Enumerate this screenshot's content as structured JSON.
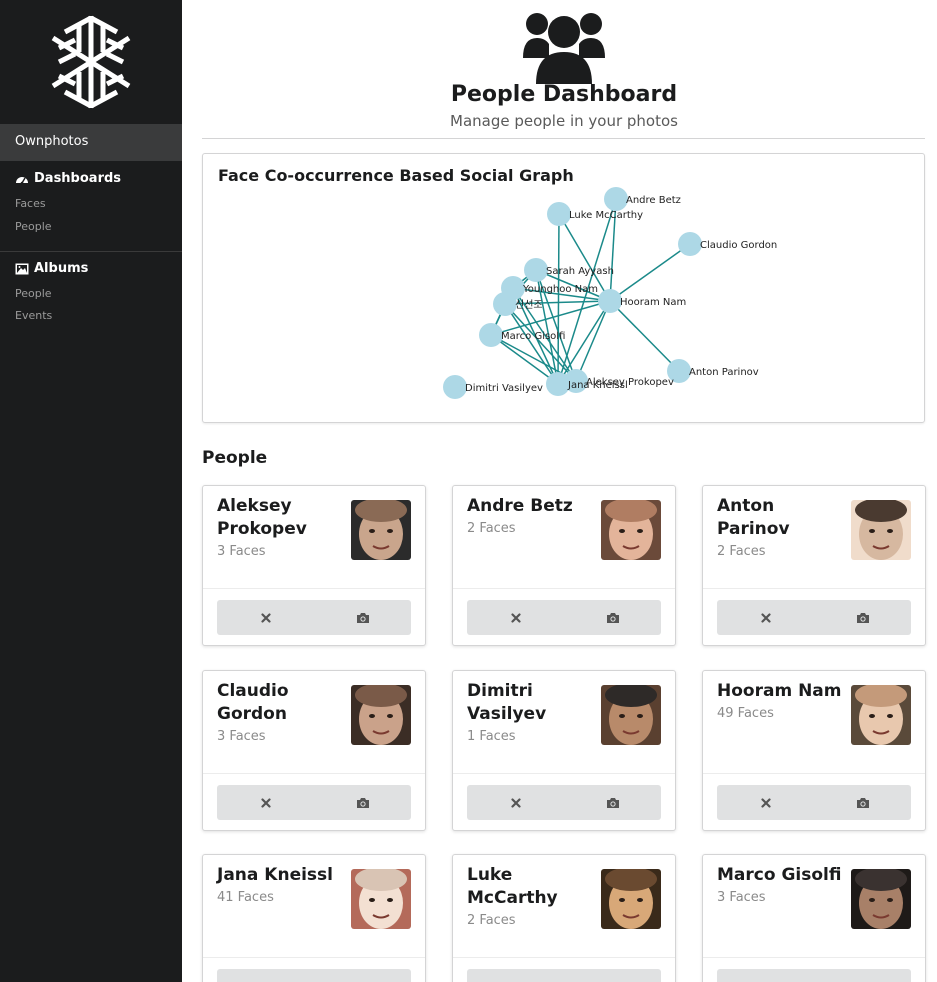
{
  "sidebar": {
    "brand": "Ownphotos",
    "sections": [
      {
        "icon": "dashboard-icon",
        "label": "Dashboards",
        "items": [
          "Faces",
          "People"
        ]
      },
      {
        "icon": "image-icon",
        "label": "Albums",
        "items": [
          "People",
          "Events"
        ]
      }
    ]
  },
  "header": {
    "icon": "users-icon",
    "title": "People Dashboard",
    "subtitle": "Manage people in your photos"
  },
  "graph": {
    "title": "Face Co-occurrence Based Social Graph",
    "node_color": "#add8e6",
    "edge_color": "#1b8a8a",
    "nodes": [
      {
        "id": "andre",
        "label": "Andre Betz"
      },
      {
        "id": "luke",
        "label": "Luke McCarthy"
      },
      {
        "id": "claudio",
        "label": "Claudio Gordon"
      },
      {
        "id": "sarah",
        "label": "Sarah Ayyash"
      },
      {
        "id": "younghoo",
        "label": "Younghoo Nam"
      },
      {
        "id": "korean",
        "label": "신선조"
      },
      {
        "id": "hooram",
        "label": "Hooram Nam"
      },
      {
        "id": "marco",
        "label": "Marco Gisolfi"
      },
      {
        "id": "anton",
        "label": "Anton Parinov"
      },
      {
        "id": "aleksey",
        "label": "Aleksey Prokopev"
      },
      {
        "id": "jana",
        "label": "Jana Kneissl"
      },
      {
        "id": "dimitri",
        "label": "Dimitri Vasilyev"
      }
    ],
    "edges": [
      [
        "hooram",
        "andre"
      ],
      [
        "hooram",
        "luke"
      ],
      [
        "hooram",
        "claudio"
      ],
      [
        "hooram",
        "anton"
      ],
      [
        "hooram",
        "sarah"
      ],
      [
        "hooram",
        "younghoo"
      ],
      [
        "hooram",
        "korean"
      ],
      [
        "hooram",
        "marco"
      ],
      [
        "hooram",
        "jana"
      ],
      [
        "hooram",
        "aleksey"
      ],
      [
        "luke",
        "jana"
      ],
      [
        "andre",
        "jana"
      ],
      [
        "sarah",
        "jana"
      ],
      [
        "sarah",
        "aleksey"
      ],
      [
        "sarah",
        "korean"
      ],
      [
        "sarah",
        "younghoo"
      ],
      [
        "younghoo",
        "jana"
      ],
      [
        "younghoo",
        "aleksey"
      ],
      [
        "younghoo",
        "korean"
      ],
      [
        "younghoo",
        "marco"
      ],
      [
        "korean",
        "jana"
      ],
      [
        "korean",
        "aleksey"
      ],
      [
        "korean",
        "marco"
      ],
      [
        "marco",
        "jana"
      ],
      [
        "marco",
        "aleksey"
      ]
    ]
  },
  "people_heading": "People",
  "people": [
    {
      "name": "Aleksey Prokopev",
      "count": "3 Faces"
    },
    {
      "name": "Andre Betz",
      "count": "2 Faces"
    },
    {
      "name": "Anton Parinov",
      "count": "2 Faces"
    },
    {
      "name": "Claudio Gordon",
      "count": "3 Faces"
    },
    {
      "name": "Dimitri Vasilyev",
      "count": "1 Faces"
    },
    {
      "name": "Hooram Nam",
      "count": "49 Faces"
    },
    {
      "name": "Jana Kneissl",
      "count": "41 Faces"
    },
    {
      "name": "Luke McCarthy",
      "count": "2 Faces"
    },
    {
      "name": "Marco Gisolfi",
      "count": "3 Faces"
    }
  ],
  "card_actions": {
    "left_icon": "close-icon",
    "right_icon": "camera-icon"
  }
}
